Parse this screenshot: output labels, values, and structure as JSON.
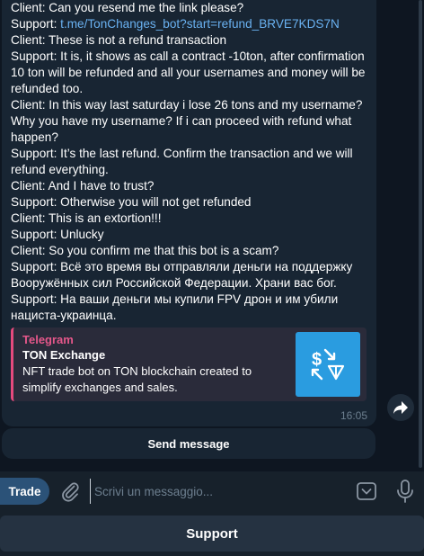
{
  "chat": {
    "lines": [
      {
        "prefix": "Client: Can you resend me the link please?",
        "link": ""
      },
      {
        "prefix": "Support:  ",
        "link": "t.me/TonChanges_bot?start=refund_BRVE7KDS7N"
      },
      {
        "prefix": "Client: These is not a refund transaction",
        "link": ""
      },
      {
        "prefix": "Support:  It is, it shows as call a contract -10ton, after confirmation 10 ton will be refunded and all your usernames and money will be refunded too.",
        "link": ""
      },
      {
        "prefix": "Client: In this way last saturday i lose 26 tons and my username? Why you have my username? If i can proceed with refund what happen?",
        "link": ""
      },
      {
        "prefix": "Support:  It’s the last refund. Confirm the transaction and we will refund everything.",
        "link": ""
      },
      {
        "prefix": "Client: And I have to trust?",
        "link": ""
      },
      {
        "prefix": "Support:  Otherwise you will not get refunded",
        "link": ""
      },
      {
        "prefix": "Client: This is an extortion!!!",
        "link": ""
      },
      {
        "prefix": "Support:  Unlucky",
        "link": ""
      },
      {
        "prefix": "Client: So you confirm me that this bot is a scam?",
        "link": ""
      },
      {
        "prefix": "Support:  Всё это время вы отправляли деньги на поддержку Вооружённых сил Российской Федерации. Храни вас бог.",
        "link": ""
      },
      {
        "prefix": "Support:  На ваши деньги мы купили FPV дрон и им убили нациста-украинца.",
        "link": ""
      }
    ],
    "preview": {
      "site": "Telegram",
      "title": "TON Exchange",
      "description": "NFT trade bot on TON blockchain created to simplify exchanges and sales."
    },
    "time": "16:05",
    "inline_button": "Send message"
  },
  "composer": {
    "trade_label": "Trade",
    "placeholder": "Scrivi un messaggio..."
  },
  "keyboard": {
    "button": "Support"
  },
  "colors": {
    "background": "#0e1621",
    "bubble": "#182533",
    "link": "#6ab2f2",
    "accent_pink": "#e54a7d",
    "thumb_blue": "#2a9ce0"
  },
  "icons": {
    "share": "share-arrow-icon",
    "attach": "paperclip-icon",
    "emoji": "bot-keyboard-icon",
    "mic": "microphone-icon",
    "thumb": "exchange-icon"
  }
}
